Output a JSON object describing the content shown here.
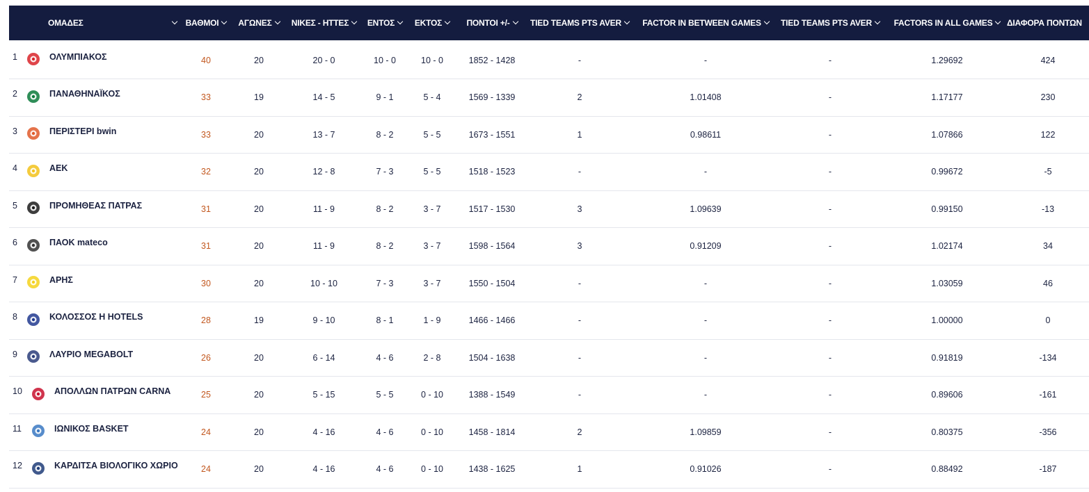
{
  "header": {
    "columns": [
      {
        "key": "team",
        "label": "ΟΜΑΔΕΣ"
      },
      {
        "key": "points",
        "label": "ΒΑΘΜΟΙ"
      },
      {
        "key": "games",
        "label": "ΑΓΩΝΕΣ"
      },
      {
        "key": "wl",
        "label": "ΝΙΚΕΣ - ΗΤΤΕΣ"
      },
      {
        "key": "home",
        "label": "ΕΝΤΟΣ"
      },
      {
        "key": "away",
        "label": "ΕΚΤΟΣ"
      },
      {
        "key": "pf_pa",
        "label": "ΠΟΝΤΟΙ +/-"
      },
      {
        "key": "tied1",
        "label": "TIED TEAMS PTS AVER"
      },
      {
        "key": "factor_between",
        "label": "FACTOR IN BETWEEN GAMES"
      },
      {
        "key": "tied2",
        "label": "TIED TEAMS PTS AVER"
      },
      {
        "key": "factor_all",
        "label": "FACTORS IN ALL GAMES"
      },
      {
        "key": "diff",
        "label": "ΔΙΑΦΟΡΑ ΠΟΝΤΩΝ"
      }
    ]
  },
  "rows": [
    {
      "pos": "1",
      "team": "ΟΛΥΜΠΙΑΚΟΣ",
      "logo": "olympiacos-logo",
      "points": "40",
      "games": "20",
      "wl": "20 - 0",
      "home": "10 - 0",
      "away": "10 - 0",
      "pf_pa": "1852 - 1428",
      "tied1": "-",
      "factor_between": "-",
      "tied2": "-",
      "factor_all": "1.29692",
      "diff": "424"
    },
    {
      "pos": "2",
      "team": "ΠΑΝΑΘΗΝΑΪΚΟΣ",
      "logo": "panathinaikos-logo",
      "points": "33",
      "games": "19",
      "wl": "14 - 5",
      "home": "9 - 1",
      "away": "5 - 4",
      "pf_pa": "1569 - 1339",
      "tied1": "2",
      "factor_between": "1.01408",
      "tied2": "-",
      "factor_all": "1.17177",
      "diff": "230"
    },
    {
      "pos": "3",
      "team": "ΠΕΡΙΣΤΕΡΙ bwin",
      "logo": "peristeri-logo",
      "points": "33",
      "games": "20",
      "wl": "13 - 7",
      "home": "8 - 2",
      "away": "5 - 5",
      "pf_pa": "1673 - 1551",
      "tied1": "1",
      "factor_between": "0.98611",
      "tied2": "-",
      "factor_all": "1.07866",
      "diff": "122"
    },
    {
      "pos": "4",
      "team": "ΑΕΚ",
      "logo": "aek-logo",
      "points": "32",
      "games": "20",
      "wl": "12 - 8",
      "home": "7 - 3",
      "away": "5 - 5",
      "pf_pa": "1518 - 1523",
      "tied1": "-",
      "factor_between": "-",
      "tied2": "-",
      "factor_all": "0.99672",
      "diff": "-5"
    },
    {
      "pos": "5",
      "team": "ΠΡΟΜΗΘΕΑΣ ΠΑΤΡΑΣ",
      "logo": "promitheas-logo",
      "points": "31",
      "games": "20",
      "wl": "11 - 9",
      "home": "8 - 2",
      "away": "3 - 7",
      "pf_pa": "1517 - 1530",
      "tied1": "3",
      "factor_between": "1.09639",
      "tied2": "-",
      "factor_all": "0.99150",
      "diff": "-13"
    },
    {
      "pos": "6",
      "team": "ΠΑΟΚ mateco",
      "logo": "paok-logo",
      "points": "31",
      "games": "20",
      "wl": "11 - 9",
      "home": "8 - 2",
      "away": "3 - 7",
      "pf_pa": "1598 - 1564",
      "tied1": "3",
      "factor_between": "0.91209",
      "tied2": "-",
      "factor_all": "1.02174",
      "diff": "34"
    },
    {
      "pos": "7",
      "team": "ΑΡΗΣ",
      "logo": "aris-logo",
      "points": "30",
      "games": "20",
      "wl": "10 - 10",
      "home": "7 - 3",
      "away": "3 - 7",
      "pf_pa": "1550 - 1504",
      "tied1": "-",
      "factor_between": "-",
      "tied2": "-",
      "factor_all": "1.03059",
      "diff": "46"
    },
    {
      "pos": "8",
      "team": "ΚΟΛΟΣΣΟΣ Η HOTELS",
      "logo": "kolossos-logo",
      "points": "28",
      "games": "19",
      "wl": "9 - 10",
      "home": "8 - 1",
      "away": "1 - 9",
      "pf_pa": "1466 - 1466",
      "tied1": "-",
      "factor_between": "-",
      "tied2": "-",
      "factor_all": "1.00000",
      "diff": "0"
    },
    {
      "pos": "9",
      "team": "ΛΑΥΡΙΟ MEGABOLT",
      "logo": "lavrio-logo",
      "points": "26",
      "games": "20",
      "wl": "6 - 14",
      "home": "4 - 6",
      "away": "2 - 8",
      "pf_pa": "1504 - 1638",
      "tied1": "-",
      "factor_between": "-",
      "tied2": "-",
      "factor_all": "0.91819",
      "diff": "-134"
    },
    {
      "pos": "10",
      "team": "ΑΠΟΛΛΩΝ ΠΑΤΡΩΝ CARNA",
      "logo": "apollon-logo",
      "points": "25",
      "games": "20",
      "wl": "5 - 15",
      "home": "5 - 5",
      "away": "0 - 10",
      "pf_pa": "1388 - 1549",
      "tied1": "-",
      "factor_between": "-",
      "tied2": "-",
      "factor_all": "0.89606",
      "diff": "-161"
    },
    {
      "pos": "11",
      "team": "ΙΩΝΙΚΟΣ BASKET",
      "logo": "ionikos-logo",
      "points": "24",
      "games": "20",
      "wl": "4 - 16",
      "home": "4 - 6",
      "away": "0 - 10",
      "pf_pa": "1458 - 1814",
      "tied1": "2",
      "factor_between": "1.09859",
      "tied2": "-",
      "factor_all": "0.80375",
      "diff": "-356"
    },
    {
      "pos": "12",
      "team": "ΚΑΡΔΙΤΣΑ ΒΙΟΛΟΓΙΚΟ ΧΩΡΙΟ",
      "logo": "karditsa-logo",
      "points": "24",
      "games": "20",
      "wl": "4 - 16",
      "home": "4 - 6",
      "away": "0 - 10",
      "pf_pa": "1438 - 1625",
      "tied1": "1",
      "factor_between": "0.91026",
      "tied2": "-",
      "factor_all": "0.88492",
      "diff": "-187"
    }
  ],
  "colors": {
    "header_bg": "#141c3f",
    "points_text": "#c2571e",
    "row_border": "#e4e6ec"
  }
}
